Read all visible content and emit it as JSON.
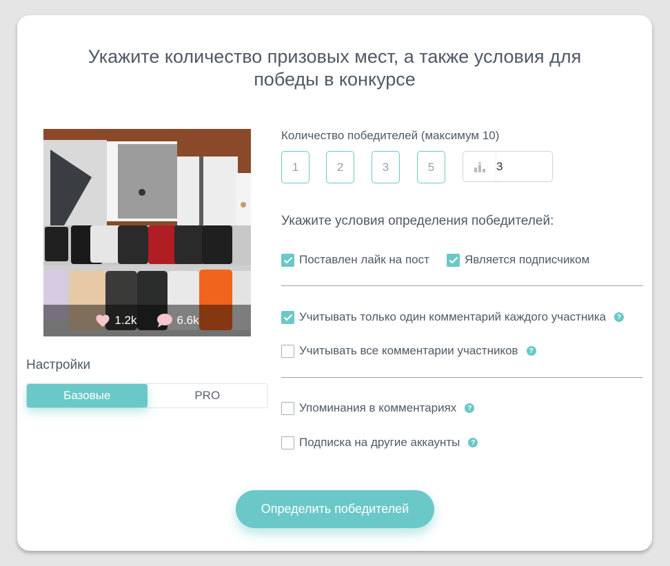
{
  "title": "Укажите количество призовых мест, а также условия для победы в конкурсе",
  "post": {
    "likes": "1.2k",
    "comments": "6.6k"
  },
  "settings": {
    "label": "Настройки",
    "tabs": [
      {
        "label": "Базовые",
        "active": true
      },
      {
        "label": "PRO",
        "active": false
      }
    ]
  },
  "winners": {
    "label": "Количество победителей (максимум 10)",
    "options": [
      "1",
      "2",
      "3",
      "5"
    ],
    "custom_value": "3"
  },
  "conditions": {
    "label": "Укажите условия определения победителей:",
    "like": {
      "label": "Поставлен лайк на пост",
      "checked": true
    },
    "subscriber": {
      "label": "Является подписчиком",
      "checked": true
    },
    "one_comment": {
      "label": "Учитывать только один комментарий каждого участника",
      "checked": true
    },
    "all_comments": {
      "label": "Учитывать все комментарии участников",
      "checked": false
    },
    "mentions": {
      "label": "Упоминания в комментариях",
      "checked": false
    },
    "other_accounts": {
      "label": "Подписка на другие аккаунты",
      "checked": false
    }
  },
  "help_glyph": "?",
  "submit_label": "Определить победителей",
  "colors": {
    "accent": "#6bc8c8",
    "background": "#e5e5e5",
    "card": "#ffffff",
    "text": "#4f5965"
  }
}
